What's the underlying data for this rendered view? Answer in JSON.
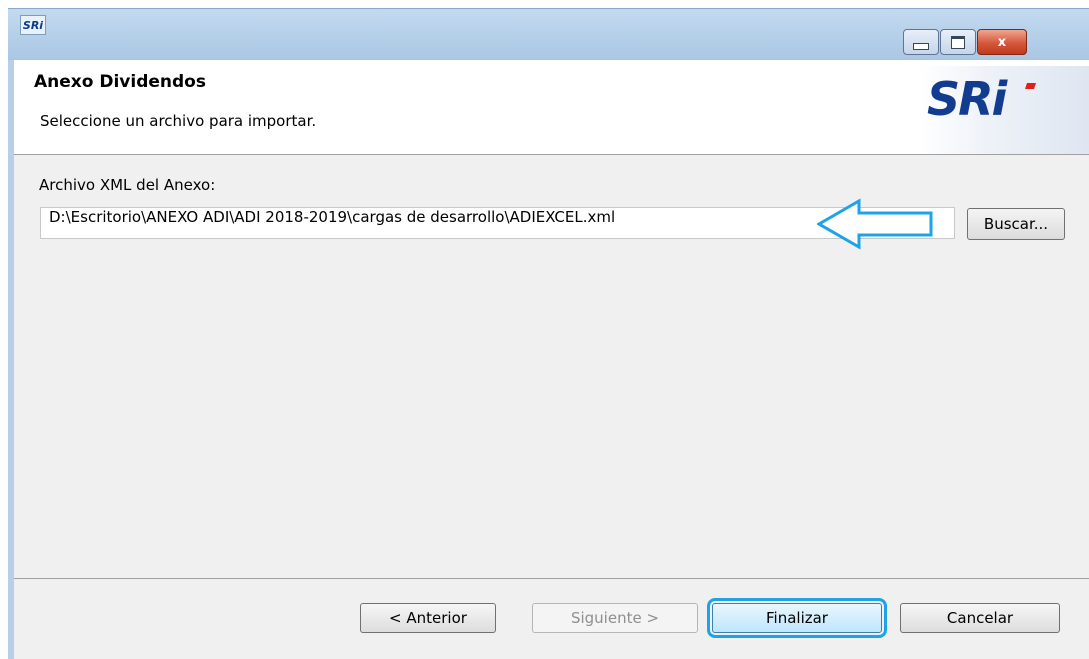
{
  "window": {
    "app_icon_label": "SRi",
    "controls": {
      "minimize": "minimize",
      "maximize": "maximize",
      "close": "x"
    }
  },
  "header": {
    "title": "Anexo Dividendos",
    "subtitle": "Seleccione un archivo para importar.",
    "logo_text": "SRi"
  },
  "form": {
    "file_label": "Archivo XML del Anexo:",
    "file_path": "D:\\Escritorio\\ANEXO ADI\\ADI 2018-2019\\cargas de desarrollo\\ADIEXCEL.xml",
    "browse_label": "Buscar..."
  },
  "footer": {
    "prev_label": "< Anterior",
    "next_label": "Siguiente >",
    "finish_label": "Finalizar",
    "cancel_label": "Cancelar"
  },
  "colors": {
    "highlight": "#1fa3e8",
    "logo_blue": "#123c8f",
    "logo_red": "#e0211a"
  }
}
